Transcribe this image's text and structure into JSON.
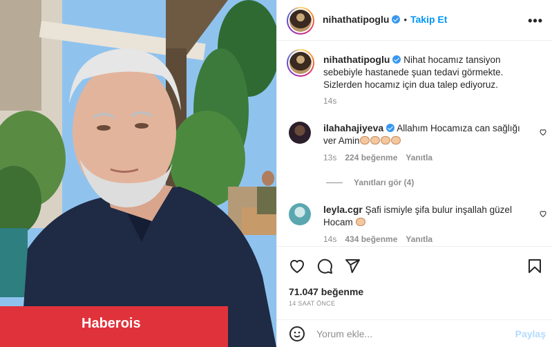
{
  "watermark": "Haberois",
  "header": {
    "username": "nihathatipoglu",
    "separator": "•",
    "follow_label": "Takip Et",
    "more_label": "•••"
  },
  "caption": {
    "username": "nihathatipoglu",
    "text": "Nihat hocamız tansiyon sebebiyle hastanede şuan tedavi görmekte. Sizlerden hocamız için dua talep ediyoruz.",
    "time": "14s"
  },
  "comments": [
    {
      "username": "ilahahajiyeva",
      "text": "Allahım Hocamıza can sağlığı ver Amin",
      "emoji_count": 4,
      "time": "13s",
      "likes": "224 beğenme",
      "reply": "Yanıtla",
      "view_replies": "Yanıtları gör (4)"
    },
    {
      "username": "leyla.cgr",
      "text": "Şafi ismiyle şifa bulur inşallah güzel Hocam",
      "emoji_count": 1,
      "time": "14s",
      "likes": "434 beğenme",
      "reply": "Yanıtla"
    }
  ],
  "actions": {
    "likes": "71.047 beğenme",
    "time": "14 SAAT ÖNCE"
  },
  "add_comment": {
    "placeholder": "Yorum ekle...",
    "post_label": "Paylaş"
  },
  "colors": {
    "accent": "#0095f6",
    "verified": "#3897f0",
    "watermark_bg": "#e0323a"
  }
}
